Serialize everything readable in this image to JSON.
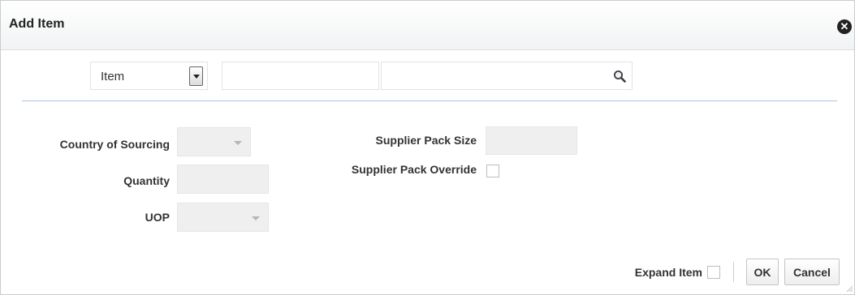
{
  "dialog": {
    "title": "Add Item",
    "close_icon": "close-icon"
  },
  "search": {
    "type_select_value": "Item",
    "item_input_value": "",
    "search_input_value": "",
    "search_icon": "search-icon"
  },
  "form": {
    "country_of_sourcing_label": "Country of Sourcing",
    "quantity_label": "Quantity",
    "uop_label": "UOP",
    "supplier_pack_size_label": "Supplier Pack Size",
    "supplier_pack_override_label": "Supplier Pack Override"
  },
  "footer": {
    "expand_item_label": "Expand Item",
    "ok_label": "OK",
    "cancel_label": "Cancel"
  },
  "colors": {
    "divider": "#a9c4dc",
    "readonly_field": "#efefef"
  }
}
